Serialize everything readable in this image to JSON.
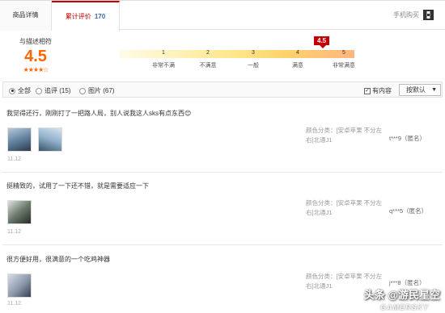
{
  "tabs": {
    "description": "商品详情",
    "reviews_label": "累计评价",
    "reviews_count": "170"
  },
  "mobile_buy": "手机购买",
  "rating": {
    "label": "与描述相符",
    "score": "4.5",
    "stars": "★★★★☆",
    "flag": "4.5",
    "ticks": [
      "1",
      "2",
      "3",
      "4",
      "5"
    ],
    "levels": [
      "非常不满",
      "不满意",
      "一般",
      "满意",
      "非常满意"
    ]
  },
  "filter": {
    "all": "全部",
    "followup": "追评 (15)",
    "images": "图片 (67)",
    "has_content": "有内容",
    "sort": "按默认"
  },
  "reviews": [
    {
      "text": "我觉得还行，刚刚打了一把路人局，别人说我这人sks有点东西😊",
      "date": "11.12",
      "sku": "颜色分类：[安卓苹果 不分左右]北通J1",
      "user": "t***9（匿名）"
    },
    {
      "text": "挺精致的，试用了一下还不错，就是需要适应一下",
      "date": "11.12",
      "sku": "颜色分类：[安卓苹果 不分左右]北通J1",
      "user": "q***5（匿名）"
    },
    {
      "text": "很方便好用，很满意的一个吃鸡神器",
      "date": "11.12",
      "sku": "颜色分类：[安卓苹果 不分左右]北通J1",
      "user": "j***8（匿名）"
    }
  ],
  "watermark": {
    "main": "头条 @游民星空",
    "sub": "GAMERSKY"
  },
  "colors": {
    "accent": "#c40000",
    "score": "#ff6600",
    "count": "#3a6da8"
  }
}
